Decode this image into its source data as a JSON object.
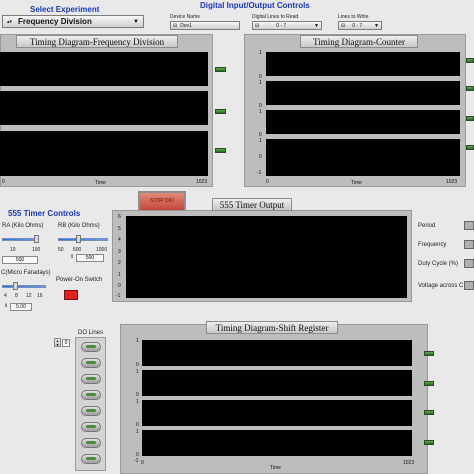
{
  "experiment": {
    "heading": "Select Experiment",
    "selected": "Frequency Division"
  },
  "dio": {
    "heading": "Digital Input/Output Controls",
    "device": {
      "label": "Device Name",
      "value": "Dev1"
    },
    "read": {
      "label": "Digital Lines to Read",
      "value": "0 - 7"
    },
    "write": {
      "label": "Lines to Write",
      "value": "0 - 7"
    }
  },
  "freq_chart": {
    "title": "Timing Diagram-Frequency Division",
    "xlabel": "Time",
    "x0": "0",
    "x1": "1023",
    "tracks": 3
  },
  "counter_chart": {
    "title": "Timing Diagram-Counter",
    "xlabel": "Time",
    "x0": "0",
    "x1": "1023",
    "ticks": [
      "1",
      "0",
      "1",
      "0",
      "1",
      "0",
      "1",
      "0",
      "-1"
    ]
  },
  "stop_button": "STOP DIO",
  "timer_chart": {
    "title": "555 Timer Output",
    "ticks": [
      "6",
      "5",
      "4",
      "3",
      "2",
      "1",
      "0",
      "-1"
    ]
  },
  "timer_controls": {
    "heading": "555 Timer Controls",
    "ra": {
      "label": "RA (Kilo Ohms)",
      "ticks": [
        "10",
        "100"
      ],
      "value": "500"
    },
    "rb": {
      "label": "RB (Kilo Ohms)",
      "ticks": [
        "50",
        "500",
        "1000"
      ],
      "value": "500"
    },
    "c": {
      "label": "C(Micro Faradays)",
      "ticks": [
        "4",
        "8",
        "12",
        "16"
      ],
      "value": "5.00"
    },
    "power": {
      "label": "Power-On Switch"
    }
  },
  "outputs": {
    "period": "Period",
    "frequency": "Frequency",
    "duty": "Duty Cycle (%)",
    "voltage": "Voltage across C"
  },
  "do_lines": {
    "label": "DO Lines",
    "index": "0",
    "count": 8
  },
  "shift_chart": {
    "title": "Timing Diagram-Shift Register",
    "xlabel": "Time",
    "x0": "0",
    "x1": "1023",
    "ticks": [
      "1",
      "0",
      "1",
      "0",
      "1",
      "0",
      "1",
      "0",
      "-1"
    ]
  },
  "colors": {
    "heading_blue": "#1a37c4",
    "led_green": "#3f8f34",
    "power_red": "#e22222",
    "plot_bg": "#000000"
  }
}
